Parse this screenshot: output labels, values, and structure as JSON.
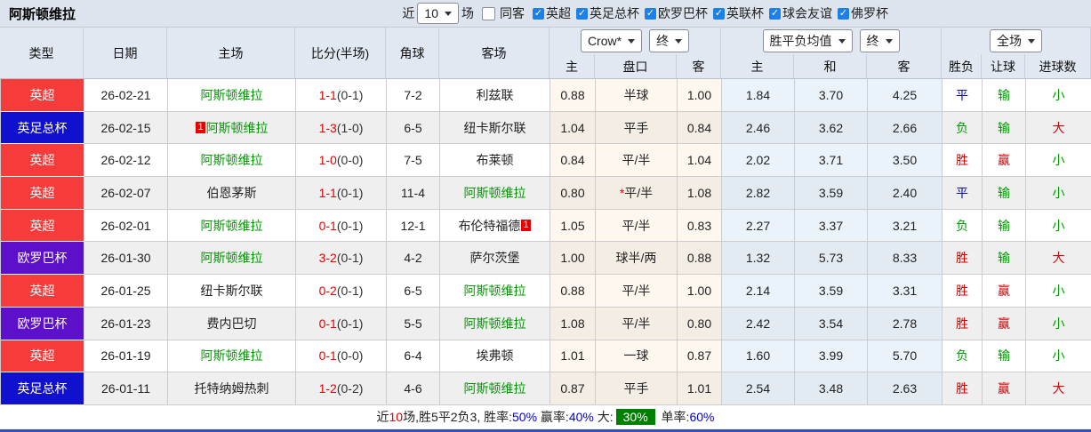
{
  "title": "阿斯顿维拉",
  "colors": {
    "league_red": "#f63b3b",
    "cup_blue": "#1110cf",
    "europa_purple": "#5c10c9",
    "team_green": "#009900",
    "score_red": "#e60000",
    "win_red": "#d40000",
    "draw_blue": "#0000e0",
    "footer_highlight_bg": "#008000"
  },
  "topbar": {
    "recent_label": "近",
    "recent_select": "10",
    "matches_label": "场",
    "same_away": {
      "label": "同客",
      "checked": false
    },
    "filters": [
      {
        "label": "英超",
        "checked": true
      },
      {
        "label": "英足总杯",
        "checked": true
      },
      {
        "label": "欧罗巴杯",
        "checked": true
      },
      {
        "label": "英联杯",
        "checked": true
      },
      {
        "label": "球会友谊",
        "checked": true
      },
      {
        "label": "佛罗杯",
        "checked": true
      }
    ]
  },
  "header": {
    "cols": [
      "类型",
      "日期",
      "主场",
      "比分(半场)",
      "角球",
      "客场"
    ],
    "selects": {
      "odds_company": "Crow*",
      "odds_time1": "终",
      "avg_mode": "胜平负均值",
      "odds_time2": "终",
      "scope": "全场"
    },
    "sub": [
      "主",
      "盘口",
      "客",
      "主",
      "和",
      "客",
      "胜负",
      "让球",
      "进球数"
    ]
  },
  "table": {
    "rows": [
      {
        "type": "英超",
        "type_color": "red",
        "date": "26-02-21",
        "home": "阿斯顿维拉",
        "home_green": true,
        "home_badge": "",
        "score": "1-1",
        "half": "(0-1)",
        "corners": "7-2",
        "away": "利兹联",
        "away_green": false,
        "away_badge": "",
        "h": "0.88",
        "handicap": "半球",
        "star": false,
        "a": "1.00",
        "avg_h": "1.84",
        "avg_d": "3.70",
        "avg_a": "4.25",
        "wdl": "平",
        "wdl_c": "blue",
        "let": "输",
        "let_c": "green",
        "goals": "小",
        "goals_c": "green"
      },
      {
        "type": "英足总杯",
        "type_color": "blue",
        "date": "26-02-15",
        "home": "阿斯顿维拉",
        "home_green": true,
        "home_badge": "1",
        "score": "1-3",
        "half": "(1-0)",
        "corners": "6-5",
        "away": "纽卡斯尔联",
        "away_green": false,
        "away_badge": "",
        "h": "1.04",
        "handicap": "平手",
        "star": false,
        "a": "0.84",
        "avg_h": "2.46",
        "avg_d": "3.62",
        "avg_a": "2.66",
        "wdl": "负",
        "wdl_c": "green",
        "let": "输",
        "let_c": "green",
        "goals": "大",
        "goals_c": "red"
      },
      {
        "type": "英超",
        "type_color": "red",
        "date": "26-02-12",
        "home": "阿斯顿维拉",
        "home_green": true,
        "home_badge": "",
        "score": "1-0",
        "half": "(0-0)",
        "corners": "7-5",
        "away": "布莱顿",
        "away_green": false,
        "away_badge": "",
        "h": "0.84",
        "handicap": "平/半",
        "star": false,
        "a": "1.04",
        "avg_h": "2.02",
        "avg_d": "3.71",
        "avg_a": "3.50",
        "wdl": "胜",
        "wdl_c": "red",
        "let": "赢",
        "let_c": "red",
        "goals": "小",
        "goals_c": "green"
      },
      {
        "type": "英超",
        "type_color": "red",
        "date": "26-02-07",
        "home": "伯恩茅斯",
        "home_green": false,
        "home_badge": "",
        "score": "1-1",
        "half": "(0-1)",
        "corners": "11-4",
        "away": "阿斯顿维拉",
        "away_green": true,
        "away_badge": "",
        "h": "0.80",
        "handicap": "平/半",
        "star": true,
        "a": "1.08",
        "avg_h": "2.82",
        "avg_d": "3.59",
        "avg_a": "2.40",
        "wdl": "平",
        "wdl_c": "blue",
        "let": "输",
        "let_c": "green",
        "goals": "小",
        "goals_c": "green"
      },
      {
        "type": "英超",
        "type_color": "red",
        "date": "26-02-01",
        "home": "阿斯顿维拉",
        "home_green": true,
        "home_badge": "",
        "score": "0-1",
        "half": "(0-1)",
        "corners": "12-1",
        "away": "布伦特福德",
        "away_green": false,
        "away_badge": "1",
        "h": "1.05",
        "handicap": "平/半",
        "star": false,
        "a": "0.83",
        "avg_h": "2.27",
        "avg_d": "3.37",
        "avg_a": "3.21",
        "wdl": "负",
        "wdl_c": "green",
        "let": "输",
        "let_c": "green",
        "goals": "小",
        "goals_c": "green"
      },
      {
        "type": "欧罗巴杯",
        "type_color": "purple",
        "date": "26-01-30",
        "home": "阿斯顿维拉",
        "home_green": true,
        "home_badge": "",
        "score": "3-2",
        "half": "(0-1)",
        "corners": "4-2",
        "away": "萨尔茨堡",
        "away_green": false,
        "away_badge": "",
        "h": "1.00",
        "handicap": "球半/两",
        "star": false,
        "a": "0.88",
        "avg_h": "1.32",
        "avg_d": "5.73",
        "avg_a": "8.33",
        "wdl": "胜",
        "wdl_c": "red",
        "let": "输",
        "let_c": "green",
        "goals": "大",
        "goals_c": "red"
      },
      {
        "type": "英超",
        "type_color": "red",
        "date": "26-01-25",
        "home": "纽卡斯尔联",
        "home_green": false,
        "home_badge": "",
        "score": "0-2",
        "half": "(0-1)",
        "corners": "6-5",
        "away": "阿斯顿维拉",
        "away_green": true,
        "away_badge": "",
        "h": "0.88",
        "handicap": "平/半",
        "star": false,
        "a": "1.00",
        "avg_h": "2.14",
        "avg_d": "3.59",
        "avg_a": "3.31",
        "wdl": "胜",
        "wdl_c": "red",
        "let": "赢",
        "let_c": "red",
        "goals": "小",
        "goals_c": "green"
      },
      {
        "type": "欧罗巴杯",
        "type_color": "purple",
        "date": "26-01-23",
        "home": "费内巴切",
        "home_green": false,
        "home_badge": "",
        "score": "0-1",
        "half": "(0-1)",
        "corners": "5-5",
        "away": "阿斯顿维拉",
        "away_green": true,
        "away_badge": "",
        "h": "1.08",
        "handicap": "平/半",
        "star": false,
        "a": "0.80",
        "avg_h": "2.42",
        "avg_d": "3.54",
        "avg_a": "2.78",
        "wdl": "胜",
        "wdl_c": "red",
        "let": "赢",
        "let_c": "red",
        "goals": "小",
        "goals_c": "green"
      },
      {
        "type": "英超",
        "type_color": "red",
        "date": "26-01-19",
        "home": "阿斯顿维拉",
        "home_green": true,
        "home_badge": "",
        "score": "0-1",
        "half": "(0-0)",
        "corners": "6-4",
        "away": "埃弗顿",
        "away_green": false,
        "away_badge": "",
        "h": "1.01",
        "handicap": "一球",
        "star": false,
        "a": "0.87",
        "avg_h": "1.60",
        "avg_d": "3.99",
        "avg_a": "5.70",
        "wdl": "负",
        "wdl_c": "green",
        "let": "输",
        "let_c": "green",
        "goals": "小",
        "goals_c": "green"
      },
      {
        "type": "英足总杯",
        "type_color": "blue",
        "date": "26-01-11",
        "home": "托特纳姆热刺",
        "home_green": false,
        "home_badge": "",
        "score": "1-2",
        "half": "(0-2)",
        "corners": "4-6",
        "away": "阿斯顿维拉",
        "away_green": true,
        "away_badge": "",
        "h": "0.87",
        "handicap": "平手",
        "star": false,
        "a": "1.01",
        "avg_h": "2.54",
        "avg_d": "3.48",
        "avg_a": "2.63",
        "wdl": "胜",
        "wdl_c": "red",
        "let": "赢",
        "let_c": "red",
        "goals": "大",
        "goals_c": "red"
      }
    ]
  },
  "footer": {
    "prefix": "近",
    "count": "10",
    "summary": "场,胜5平2负3, 胜率:",
    "win_rate": "50%",
    "label_profit": " 赢率:",
    "profit_rate": "40%",
    "label_big": " 大:",
    "big_rate": "30%",
    "label_single": " 单率:",
    "single_rate": "60%"
  }
}
